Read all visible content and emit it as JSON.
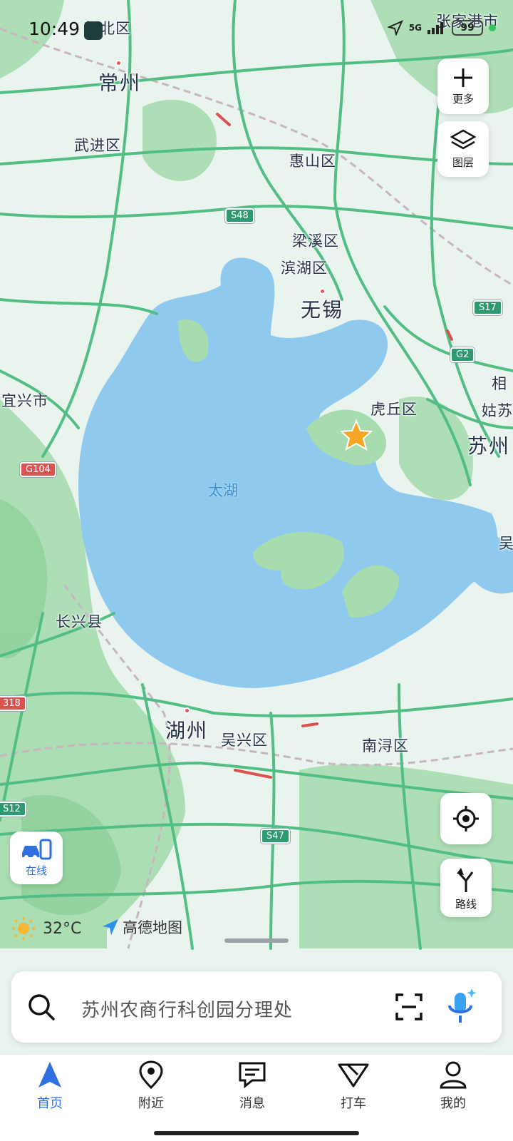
{
  "status_bar": {
    "time": "10:49",
    "network": "5G",
    "battery": "99",
    "colors": {
      "battery_dot": "#33c45a"
    }
  },
  "map": {
    "colors": {
      "land": "#eaf4ef",
      "forest": "#9ed8a6",
      "water": "#8fcaee",
      "road": "#52be84",
      "congestion": "#d9534f",
      "railway": "#c9b5c0"
    },
    "place_labels": {
      "xinbei": "新北区",
      "zhangjiagang": "张家港市",
      "changzhou": "常州",
      "wujin": "武进区",
      "huishan": "惠山区",
      "liangxi": "梁溪区",
      "binhu": "滨湖区",
      "wuxi": "无锡",
      "yixing": "宜兴市",
      "huqiu": "虎丘区",
      "gusu": "姑苏",
      "suzhou": "苏州",
      "taihu": "太湖",
      "changxing": "长兴县",
      "huzhou": "湖州",
      "wuxing": "吴兴区",
      "nanxun": "南浔区",
      "edge_xiang": "相",
      "edge_wu": "吴"
    },
    "road_shields": {
      "s48": "S48",
      "s17": "S17",
      "g2": "G2",
      "g104": "G104",
      "s318": "318",
      "s12": "S12",
      "s47": "S47"
    },
    "favorite_icon": "star-icon"
  },
  "controls": {
    "more_label": "更多",
    "layers_label": "图层",
    "route_label": "路线",
    "online_label": "在线"
  },
  "weather": {
    "temperature": "32°C",
    "icon": "sun-icon"
  },
  "brand": {
    "name": "高德地图"
  },
  "search": {
    "placeholder": "苏州农商行科创园分理处",
    "icons": [
      "search-icon",
      "scan-icon",
      "voice-assistant-icon"
    ]
  },
  "bottom_nav": {
    "items": [
      {
        "label": "首页",
        "icon": "home-arrow-icon",
        "active": true
      },
      {
        "label": "附近",
        "icon": "location-pin-icon",
        "active": false
      },
      {
        "label": "消息",
        "icon": "message-icon",
        "active": false
      },
      {
        "label": "打车",
        "icon": "taxi-icon",
        "active": false
      },
      {
        "label": "我的",
        "icon": "user-icon",
        "active": false
      }
    ],
    "active_color": "#2f6fe0"
  }
}
